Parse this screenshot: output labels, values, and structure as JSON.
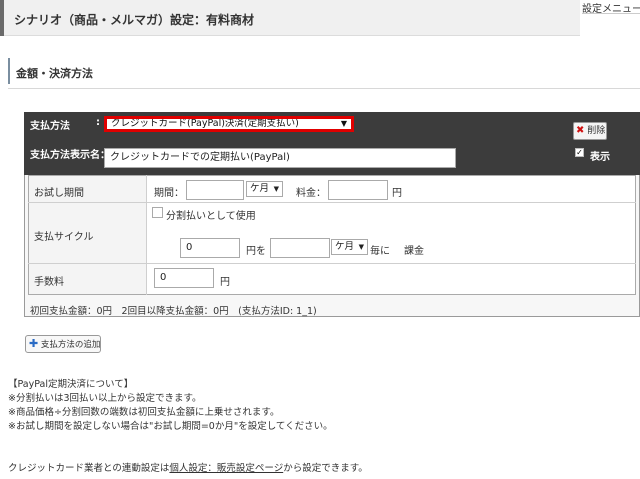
{
  "header": {
    "title": "シナリオ（商品・メルマガ）設定：有料商材",
    "menu_link": "設定メニュー"
  },
  "section": {
    "title": "金額・決済方法"
  },
  "payment": {
    "method_label": "支払方法",
    "method_colon": ":",
    "method_value": "クレジットカード(PayPal)決済(定期支払い)",
    "display_name_label": "支払方法表示名：",
    "display_name_value": "クレジットカードでの定期払い(PayPal)",
    "delete_label": "削除",
    "show_label": "表示",
    "show_checked": "✓"
  },
  "trial": {
    "label": "お試し期間",
    "period_label": "期間：",
    "period_value": "",
    "unit_value": "ケ月",
    "fee_label": "料金：",
    "fee_value": "",
    "currency": "円"
  },
  "cycle": {
    "label": "支払サイクル",
    "installment_label": "分割払いとして使用",
    "amount_value": "0",
    "amount_suffix": "円を",
    "interval_value": "",
    "unit_value": "ケ月",
    "every_label": "毎に",
    "charge_label": "課金"
  },
  "fee": {
    "label": "手数料",
    "value": "0",
    "currency": "円"
  },
  "summary": "初回支払金額：0円　2回目以降支払金額：0円　(支払方法ID: 1_1)",
  "add_button": "支払方法の追加",
  "notes": [
    "【PayPal定期決済について】",
    "※分割払いは3回払い以上から設定できます。",
    "※商品価格÷分割回数の端数は初回支払金額に上乗せされます。",
    "※お試し期間を設定しない場合は\"お試し期間=0か月\"を設定してください。"
  ],
  "footer": {
    "prefix": "クレジットカード業者との連動設定は",
    "link": "個人設定：販売設定ページ",
    "suffix": "から設定できます。"
  }
}
